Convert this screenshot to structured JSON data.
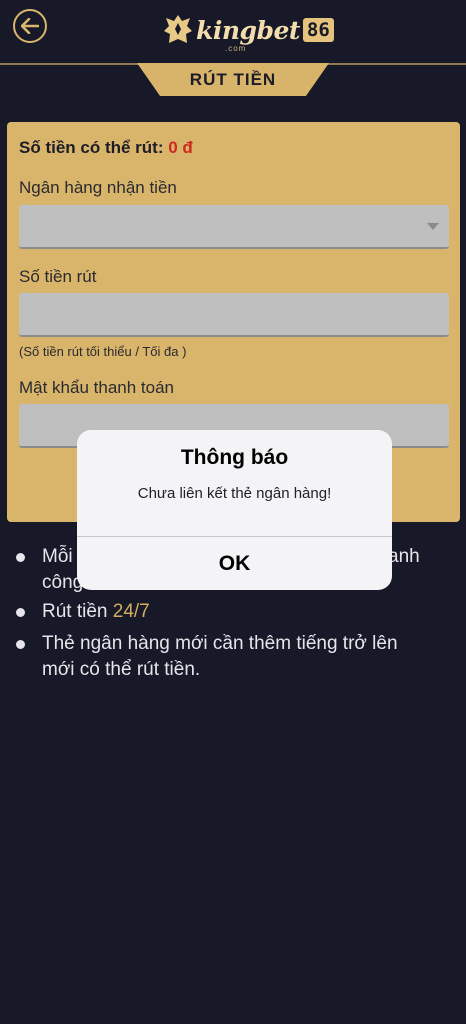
{
  "header": {
    "logo_word": "kingbet",
    "logo_number": "86",
    "logo_domain": ".com"
  },
  "page": {
    "title": "RÚT TIỀN"
  },
  "form": {
    "balance_label": "Số tiền có thể rút:",
    "balance_value": "0 đ",
    "bank_label": "Ngân hàng nhận tiền",
    "amount_label": "Số tiền rút",
    "amount_hint": "(Số tiền rút tối thiểu / Tối đa )",
    "password_label": "Mật khẩu thanh toán"
  },
  "notes": [
    {
      "text": "Mỗi",
      "trail": "anh",
      "line2": "công"
    },
    {
      "text": "Rút tiền ",
      "highlight": "24/7"
    },
    {
      "text": "Thẻ ngân hàng mới cần thêm tiếng trở lên mới có thể rút tiền."
    }
  ],
  "dialog": {
    "title": "Thông báo",
    "message": "Chưa liên kết thẻ ngân hàng!",
    "ok_label": "OK"
  },
  "colors": {
    "background": "#171828",
    "accent_gold": "#d8b46a",
    "balance_red": "#cc2b1e"
  }
}
